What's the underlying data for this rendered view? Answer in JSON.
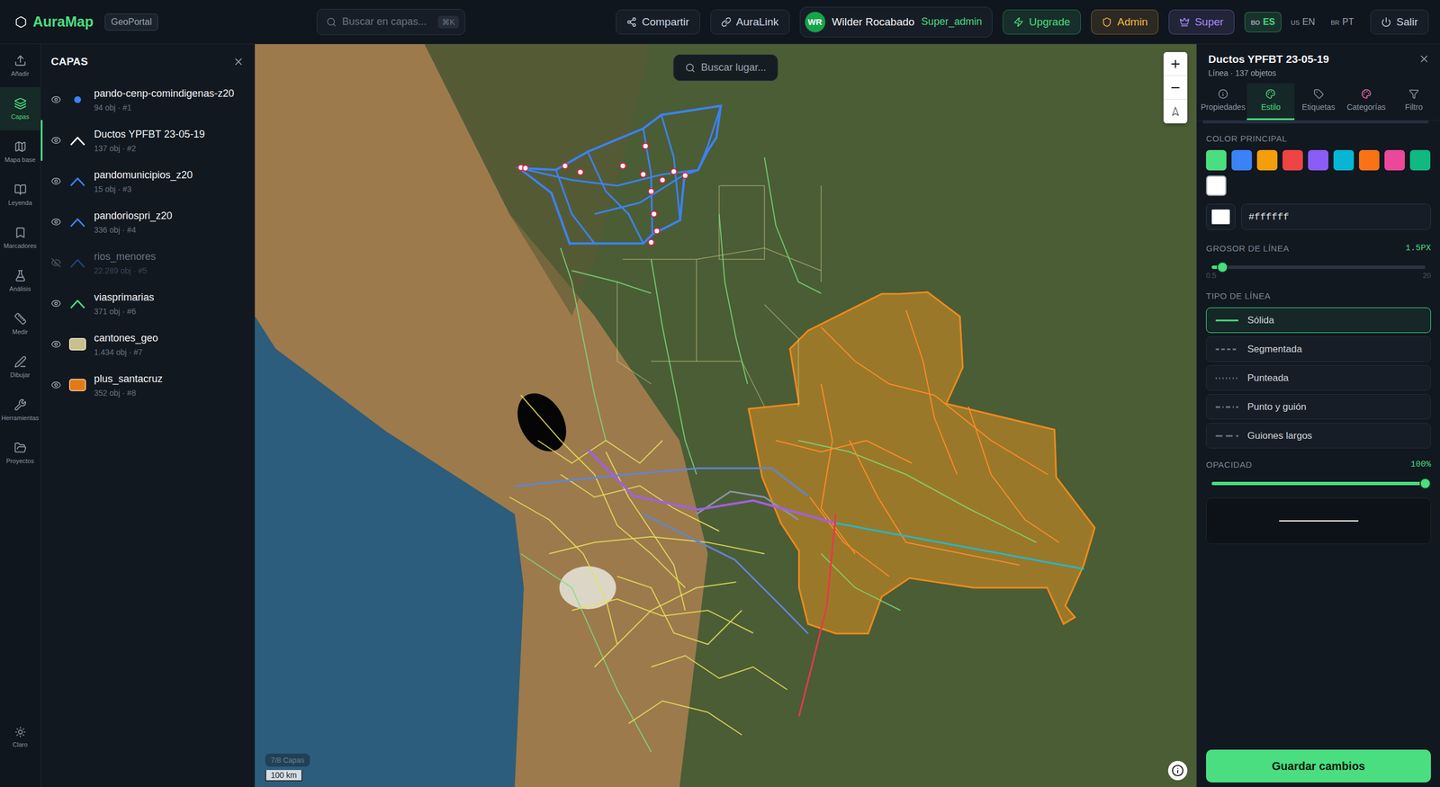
{
  "app": {
    "logo": "AuraMap",
    "badge": "GeoPortal"
  },
  "search": {
    "placeholder": "Buscar en capas...",
    "shortcut": "⌘K"
  },
  "topbar_buttons": [
    {
      "label": "Compartir"
    },
    {
      "label": "AuraLink"
    }
  ],
  "user": {
    "initials": "WR",
    "name": "Wilder Rocabado",
    "role": "Super_admin"
  },
  "role_buttons": [
    {
      "label": "Upgrade",
      "color": "#4ade80"
    },
    {
      "label": "Admin",
      "color": "#f5b942"
    },
    {
      "label": "Super",
      "color": "#a78bfa"
    }
  ],
  "languages": [
    {
      "flag": "BO",
      "code": "ES",
      "selected": true
    },
    {
      "flag": "US",
      "code": "EN",
      "selected": false
    },
    {
      "flag": "BR",
      "code": "PT",
      "selected": false
    }
  ],
  "logout": "Salir",
  "rail": {
    "items": [
      {
        "label": "Añadir",
        "selected": false
      },
      {
        "label": "Capas",
        "selected": true
      },
      {
        "label": "Mapa base",
        "selected": false
      },
      {
        "label": "Leyenda",
        "selected": false
      },
      {
        "label": "Marcadores",
        "selected": false
      },
      {
        "label": "Análisis",
        "selected": false
      },
      {
        "label": "Medir",
        "selected": false
      },
      {
        "label": "Dibujar",
        "selected": false
      },
      {
        "label": "Herramientas",
        "selected": false
      },
      {
        "label": "Proyectos",
        "selected": false
      }
    ],
    "theme": "Claro"
  },
  "layers_panel": {
    "title": "CAPAS",
    "layers": [
      {
        "name": "pando-cenp-comindigenas-z20",
        "meta": "94 obj · #1",
        "kind": "point",
        "color": "#3b82f6",
        "visible": true,
        "selected": false
      },
      {
        "name": "Ductos YPFBT 23-05-19",
        "meta": "137 obj · #2",
        "kind": "line",
        "color": "#ffffff",
        "visible": true,
        "selected": true
      },
      {
        "name": "pandomunicipios_z20",
        "meta": "15 obj · #3",
        "kind": "line",
        "color": "#3b82f6",
        "visible": true,
        "selected": false
      },
      {
        "name": "pandoriospri_z20",
        "meta": "336 obj · #4",
        "kind": "line",
        "color": "#3b82f6",
        "visible": true,
        "selected": false
      },
      {
        "name": "rios_menores",
        "meta": "22.289 obj · #5",
        "kind": "line",
        "color": "#3b82f6",
        "visible": false,
        "selected": false
      },
      {
        "name": "viasprimarias",
        "meta": "371 obj · #6",
        "kind": "line",
        "color": "#4ade80",
        "visible": true,
        "selected": false
      },
      {
        "name": "cantones_geo",
        "meta": "1.434 obj · #7",
        "kind": "polygon",
        "color": "#c9c089",
        "visible": true,
        "selected": false
      },
      {
        "name": "plus_santacruz",
        "meta": "352 obj · #8",
        "kind": "polygon",
        "color": "#e07b1a",
        "visible": true,
        "selected": false
      }
    ]
  },
  "map": {
    "search_placeholder": "Buscar lugar...",
    "scale": "100 km",
    "layer_count": "7/8 Capas"
  },
  "style_panel": {
    "title": "Ductos YPFBT 23-05-19",
    "subtitle": "Línea · 137 objetos",
    "tabs": [
      {
        "label": "Propiedades",
        "selected": false
      },
      {
        "label": "Estilo",
        "selected": true
      },
      {
        "label": "Etiquetas",
        "selected": false
      },
      {
        "label": "Categorías",
        "selected": false
      },
      {
        "label": "Filtro",
        "selected": false
      }
    ],
    "color_label": "COLOR PRINCIPAL",
    "swatches": [
      {
        "color": "#4ade80",
        "selected": false
      },
      {
        "color": "#3b82f6",
        "selected": false
      },
      {
        "color": "#f59e0b",
        "selected": false
      },
      {
        "color": "#ef4444",
        "selected": false
      },
      {
        "color": "#8b5cf6",
        "selected": false
      },
      {
        "color": "#06b6d4",
        "selected": false
      },
      {
        "color": "#f97316",
        "selected": false
      },
      {
        "color": "#ec4899",
        "selected": false
      },
      {
        "color": "#10b981",
        "selected": false
      },
      {
        "color": "#ffffff",
        "selected": true
      }
    ],
    "hex": "#ffffff",
    "width": {
      "label": "GROSOR DE LÍNEA",
      "reading": "1.5PX",
      "level": 0.05,
      "min": "0.5",
      "max": "20"
    },
    "line_types": {
      "label": "TIPO DE LÍNEA",
      "options": [
        {
          "label": "Sólida",
          "kind": "solid",
          "selected": true
        },
        {
          "label": "Segmentada",
          "kind": "dashed",
          "selected": false
        },
        {
          "label": "Punteada",
          "kind": "dotted",
          "selected": false
        },
        {
          "label": "Punto y guión",
          "kind": "dashdot",
          "selected": false
        },
        {
          "label": "Guiones largos",
          "kind": "longdash",
          "selected": false
        }
      ]
    },
    "opacity": {
      "label": "OPACIDAD",
      "reading": "100%",
      "level": 1
    },
    "save": "Guardar cambios"
  }
}
